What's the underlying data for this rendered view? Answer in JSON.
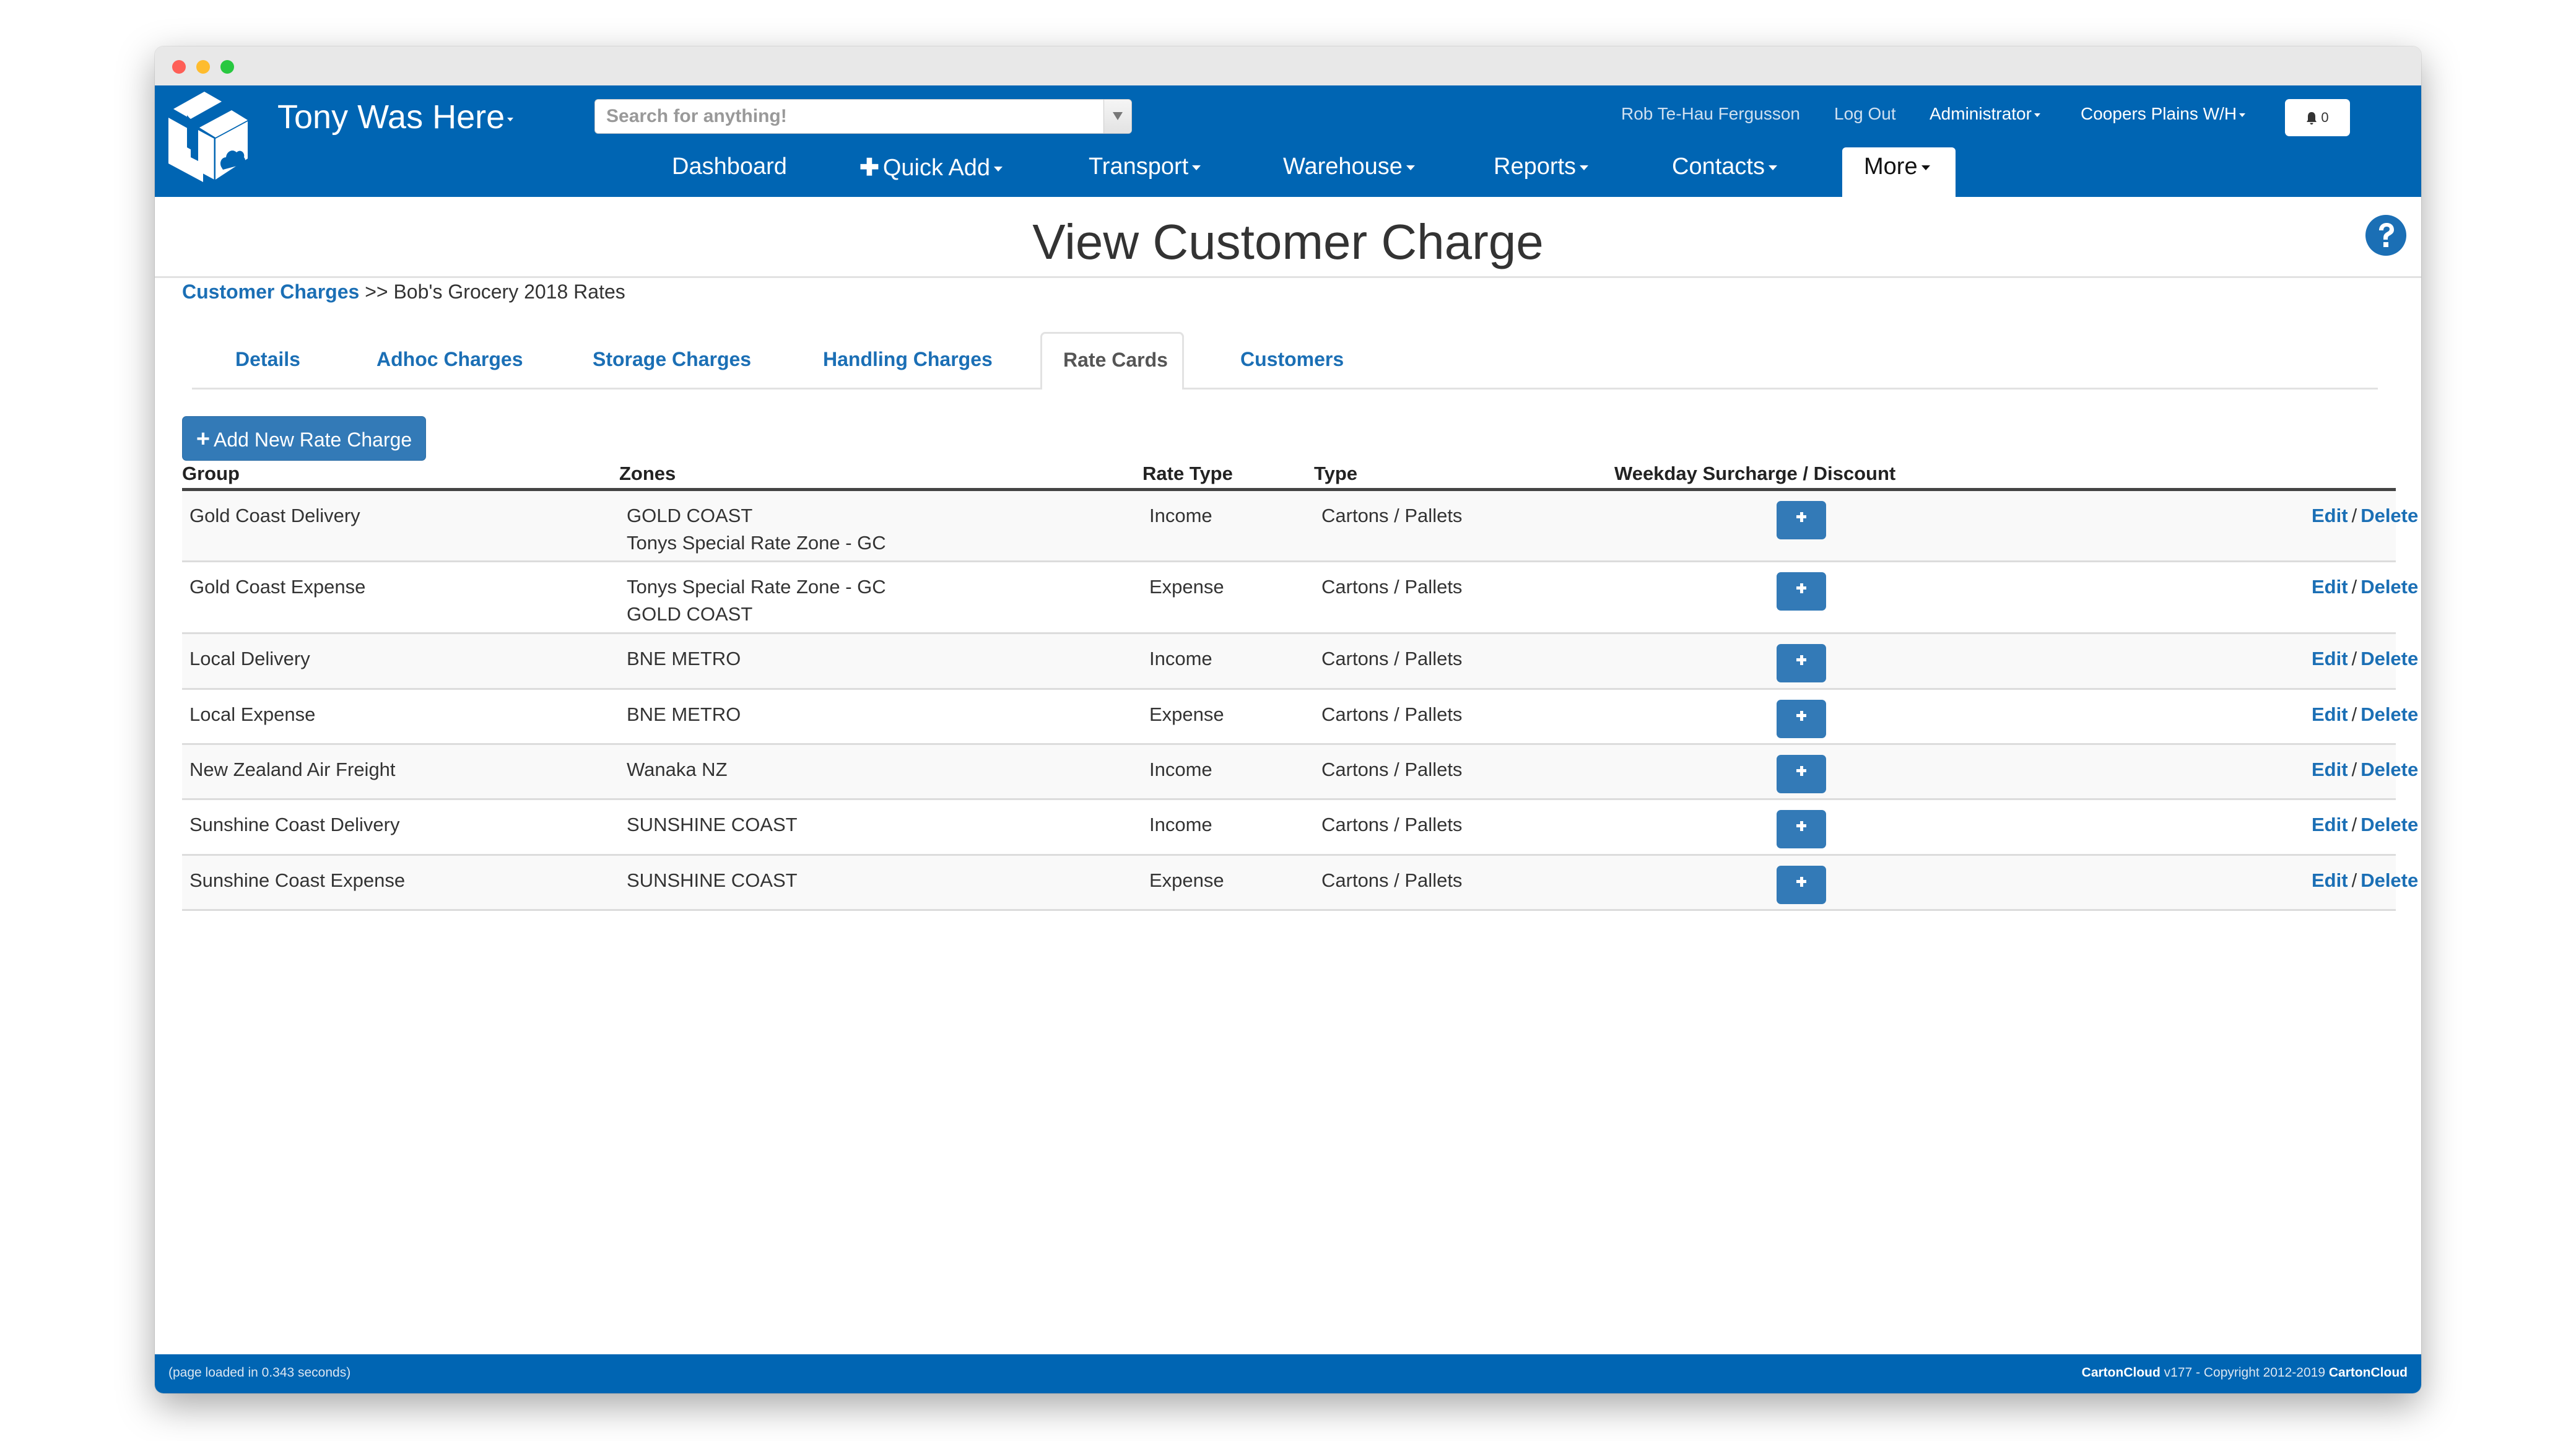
{
  "window": {
    "traffic_lights": [
      "close",
      "minimize",
      "maximize"
    ]
  },
  "header": {
    "brand": "Tony Was Here",
    "logo_icon": "carton-cloud-box-icon",
    "search": {
      "placeholder": "Search for anything!",
      "value": ""
    },
    "user_name": "Rob Te-Hau Fergusson",
    "logout": "Log Out",
    "role": "Administrator",
    "warehouse": "Coopers Plains W/H",
    "notifications": {
      "icon": "bell-icon",
      "count": "0"
    },
    "nav": [
      {
        "label": "Dashboard",
        "caret": false
      },
      {
        "label": "Quick Add",
        "icon": "plus-icon",
        "caret": true
      },
      {
        "label": "Transport",
        "caret": true
      },
      {
        "label": "Warehouse",
        "caret": true
      },
      {
        "label": "Reports",
        "caret": true
      },
      {
        "label": "Contacts",
        "caret": true
      },
      {
        "label": "More",
        "caret": true,
        "active": true
      }
    ]
  },
  "page": {
    "title": "View Customer Charge",
    "help_icon": "question-circle-icon",
    "breadcrumb": {
      "link": "Customer Charges",
      "separator": ">>",
      "current": "Bob's Grocery 2018 Rates"
    },
    "tabs": [
      {
        "label": "Details"
      },
      {
        "label": "Adhoc Charges"
      },
      {
        "label": "Storage Charges"
      },
      {
        "label": "Handling Charges"
      },
      {
        "label": "Rate Cards",
        "active": true
      },
      {
        "label": "Customers"
      }
    ],
    "add_button": "Add New Rate Charge"
  },
  "table": {
    "columns": [
      "Group",
      "Zones",
      "Rate Type",
      "Type",
      "Weekday Surcharge / Discount",
      ""
    ],
    "rows": [
      {
        "group": "Gold Coast Delivery",
        "zones": [
          "GOLD COAST",
          "Tonys Special Rate Zone - GC"
        ],
        "rate_type": "Income",
        "type": "Cartons / Pallets"
      },
      {
        "group": "Gold Coast Expense",
        "zones": [
          "Tonys Special Rate Zone - GC",
          "GOLD COAST"
        ],
        "rate_type": "Expense",
        "type": "Cartons / Pallets"
      },
      {
        "group": "Local Delivery",
        "zones": [
          "BNE METRO"
        ],
        "rate_type": "Income",
        "type": "Cartons / Pallets"
      },
      {
        "group": "Local Expense",
        "zones": [
          "BNE METRO"
        ],
        "rate_type": "Expense",
        "type": "Cartons / Pallets"
      },
      {
        "group": "New Zealand Air Freight",
        "zones": [
          "Wanaka NZ"
        ],
        "rate_type": "Income",
        "type": "Cartons / Pallets"
      },
      {
        "group": "Sunshine Coast Delivery",
        "zones": [
          "SUNSHINE COAST"
        ],
        "rate_type": "Income",
        "type": "Cartons / Pallets"
      },
      {
        "group": "Sunshine Coast Expense",
        "zones": [
          "SUNSHINE COAST"
        ],
        "rate_type": "Expense",
        "type": "Cartons / Pallets"
      }
    ],
    "edit_label": "Edit",
    "action_separator": "/",
    "delete_label": "Delete"
  },
  "footer": {
    "load_time": "(page loaded in 0.343 seconds)",
    "brand_a": "CartonCloud",
    "version_text": "v177 - Copyright 2012-2019",
    "brand_b": "CartonCloud"
  },
  "colors": {
    "header_blue": "#0065b3",
    "button_blue": "#337ab7",
    "link_blue": "#1b6fb5"
  }
}
